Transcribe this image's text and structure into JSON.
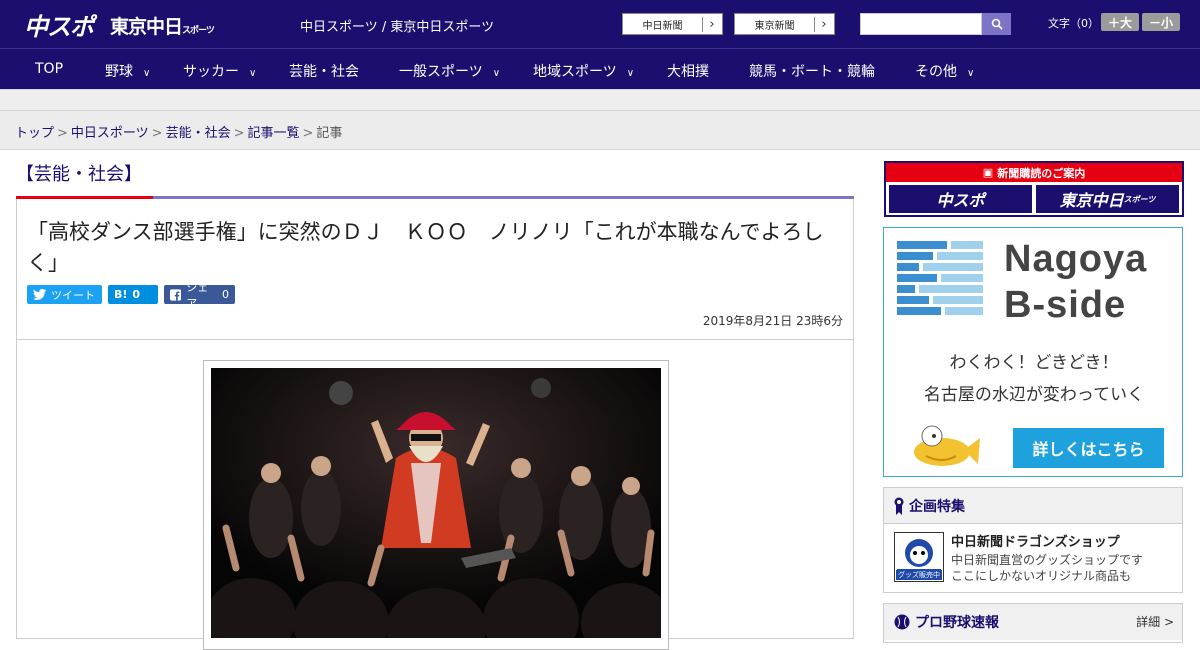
{
  "header": {
    "logo_main": "中スポ",
    "logo_tokyo": "東京中日",
    "logo_tokyo_small": "スポーツ",
    "site_names": "中日スポーツ / 東京中日スポーツ",
    "ext_links": [
      "中日新聞",
      "東京新聞"
    ],
    "search_placeholder": "",
    "fontsize_label": "文字（0）",
    "fontsize_plus": "＋大",
    "fontsize_minus": "－小"
  },
  "nav": {
    "items": [
      {
        "label": "TOP",
        "dropdown": false
      },
      {
        "label": "野球",
        "dropdown": true
      },
      {
        "label": "サッカー",
        "dropdown": true
      },
      {
        "label": "芸能・社会",
        "dropdown": false
      },
      {
        "label": "一般スポーツ",
        "dropdown": true
      },
      {
        "label": "地域スポーツ",
        "dropdown": true
      },
      {
        "label": "大相撲",
        "dropdown": false
      },
      {
        "label": "競馬・ボート・競輪",
        "dropdown": false
      },
      {
        "label": "その他",
        "dropdown": true
      }
    ]
  },
  "breadcrumb": {
    "items": [
      "トップ",
      "中日スポーツ",
      "芸能・社会",
      "記事一覧"
    ],
    "current": "記事",
    "separator": ">"
  },
  "article": {
    "section": "【芸能・社会】",
    "headline": "「高校ダンス部選手権」に突然のＤＪ　ＫＯＯ　ノリノリ「これが本職なんでよろしく」",
    "share": {
      "tweet_label": "ツイート",
      "hatena_label": "B!",
      "hatena_count": "0",
      "facebook_label": "シェア",
      "facebook_count": "0"
    },
    "date": "2019年8月21日 23時6分"
  },
  "sidebar": {
    "subscribe_title": "新聞購読のご案内",
    "subscribe_buttons": [
      "中スポ",
      "東京中日"
    ],
    "subscribe_small": "スポーツ",
    "ad": {
      "title_line1": "Nagoya",
      "title_line2": "B-side",
      "text_line1": "わくわく！どきどき！",
      "text_line2": "名古屋の水辺が変わっていく",
      "button": "詳しくはこちら"
    },
    "feature": {
      "heading": "企画特集",
      "shop_title": "中日新聞ドラゴンズショップ",
      "shop_desc_line1": "中日新聞直営のグッズショップです",
      "shop_desc_line2": "ここにしかないオリジナル商品も",
      "shop_badge": "グッズ販売中"
    },
    "baseball": {
      "heading": "プロ野球速報",
      "details": "詳細 >"
    }
  },
  "colors": {
    "header_bg": "#1a0f6e",
    "accent_red": "#e60012",
    "accent_purple": "#7b74c7",
    "twitter": "#1da1f2",
    "hatena": "#008fde",
    "facebook": "#3b5998",
    "ad_blue": "#1fa1de"
  }
}
